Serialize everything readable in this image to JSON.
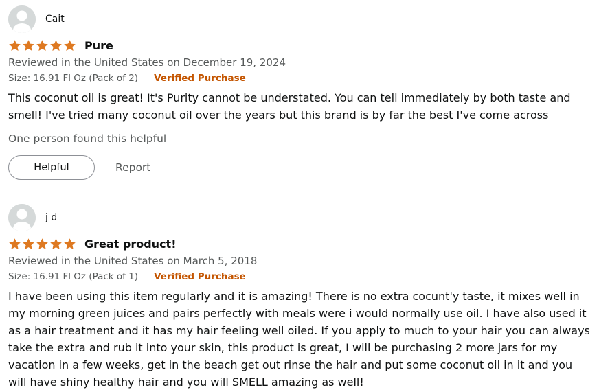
{
  "reviews": [
    {
      "author": "Cait",
      "rating": 5,
      "rating_max": 5,
      "title": "Pure",
      "date_text": "Reviewed in the United States on December 19, 2024",
      "variant": "Size: 16.91 Fl Oz (Pack of 2)",
      "verified": "Verified Purchase",
      "body": "This coconut oil is great! It's Purity cannot be understated. You can tell immediately by both taste and smell! I've tried many coconut oil over the years but this brand is by far the best I've come across",
      "helpful_count": "One person found this helpful",
      "helpful_label": "Helpful",
      "report_label": "Report"
    },
    {
      "author": "j d",
      "rating": 5,
      "rating_max": 5,
      "title": "Great product!",
      "date_text": "Reviewed in the United States on March 5, 2018",
      "variant": "Size: 16.91 Fl Oz (Pack of 1)",
      "verified": "Verified Purchase",
      "body": "I have been using this item regularly and it is amazing! There is no extra cocunt'y taste, it mixes well in my morning green juices and pairs perfectly with meals were i would normally use oil. I have also used it as a hair treatment and it has my hair feeling well oiled. If you apply to much to your hair you can always take the extra and rub it into your skin, this product is great, I will be purchasing 2 more jars for my vacation in a few weeks, get in the beach get out rinse the hair and put some coconut oil in it and you will have shiny healthy hair and you will SMELL amazing as well!"
    }
  ],
  "colors": {
    "star": "#de7921",
    "verified": "#c45500",
    "secondary_text": "#565959",
    "avatar_bg": "#d5d9d9",
    "avatar_fg": "#ffffff"
  },
  "icons": {
    "avatar": "default-avatar-icon",
    "star": "star-icon"
  }
}
